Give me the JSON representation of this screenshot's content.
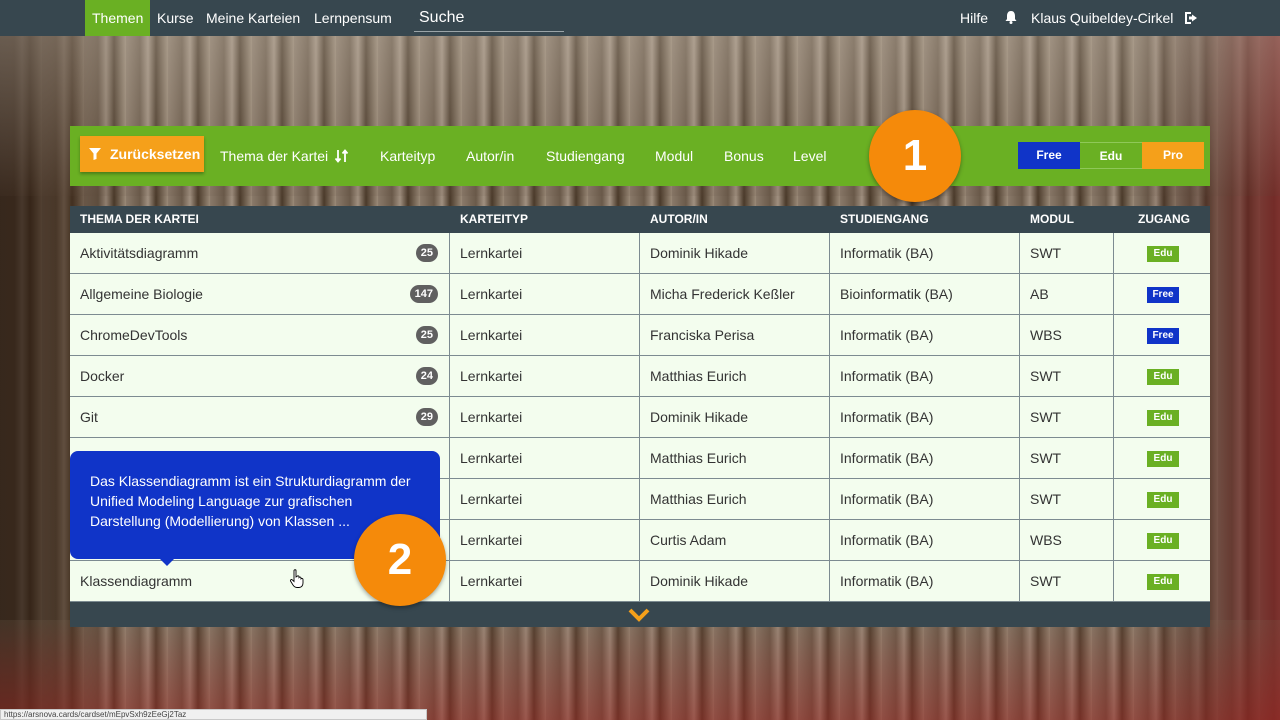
{
  "nav": {
    "items": [
      "Themen",
      "Kurse",
      "Meine Karteien",
      "Lernpensum"
    ],
    "search_placeholder": "Suche",
    "help": "Hilfe",
    "user": "Klaus Quibeldey-Cirkel",
    "bell_icon": "bell-icon",
    "logout_icon": "logout-icon"
  },
  "filterbar": {
    "reset_label": "Zurücksetzen",
    "filters": [
      "Thema der Kartei",
      "Karteityp",
      "Autor/in",
      "Studiengang",
      "Modul",
      "Bonus",
      "Level"
    ],
    "segments": [
      {
        "label": "Free",
        "color": "#1034c8"
      },
      {
        "label": "Edu",
        "color": "#6ab023"
      },
      {
        "label": "Pro",
        "color": "#f5a01a"
      }
    ]
  },
  "callouts": {
    "one": "1",
    "two": "2"
  },
  "table": {
    "headers": [
      "THEMA DER KARTEI",
      "KARTEITYP",
      "AUTOR/IN",
      "STUDIENGANG",
      "MODUL",
      "ZUGANG"
    ],
    "rows": [
      {
        "topic": "Aktivitätsdiagramm",
        "count": "25",
        "type": "Lernkartei",
        "author": "Dominik Hikade",
        "program": "Informatik (BA)",
        "module": "SWT",
        "access": "Edu"
      },
      {
        "topic": "Allgemeine Biologie",
        "count": "147",
        "type": "Lernkartei",
        "author": "Micha Frederick Keßler",
        "program": "Bioinformatik (BA)",
        "module": "AB",
        "access": "Free"
      },
      {
        "topic": "ChromeDevTools",
        "count": "25",
        "type": "Lernkartei",
        "author": "Franciska Perisa",
        "program": "Informatik (BA)",
        "module": "WBS",
        "access": "Free"
      },
      {
        "topic": "Docker",
        "count": "24",
        "type": "Lernkartei",
        "author": "Matthias Eurich",
        "program": "Informatik (BA)",
        "module": "SWT",
        "access": "Edu"
      },
      {
        "topic": "Git",
        "count": "29",
        "type": "Lernkartei",
        "author": "Dominik Hikade",
        "program": "Informatik (BA)",
        "module": "SWT",
        "access": "Edu"
      },
      {
        "topic": "",
        "count": "",
        "type": "Lernkartei",
        "author": "Matthias Eurich",
        "program": "Informatik (BA)",
        "module": "SWT",
        "access": "Edu"
      },
      {
        "topic": "",
        "count": "",
        "type": "Lernkartei",
        "author": "Matthias Eurich",
        "program": "Informatik (BA)",
        "module": "SWT",
        "access": "Edu"
      },
      {
        "topic": "",
        "count": "",
        "type": "Lernkartei",
        "author": "Curtis Adam",
        "program": "Informatik (BA)",
        "module": "WBS",
        "access": "Edu"
      },
      {
        "topic": "Klassendiagramm",
        "count": "",
        "type": "Lernkartei",
        "author": "Dominik Hikade",
        "program": "Informatik (BA)",
        "module": "SWT",
        "access": "Edu"
      }
    ]
  },
  "tooltip": {
    "text": "Das Klassendiagramm ist ein Strukturdiagramm der Unified Modeling Language zur grafischen Darstellung (Modellierung) von Klassen ..."
  },
  "statusbar": {
    "url": "https://arsnova.cards/cardset/mEpvSxh9zEeGj2Taz"
  },
  "colors": {
    "green": "#6ab023",
    "orange": "#f5a01a",
    "blue": "#1034c8",
    "dark": "#37474f"
  }
}
